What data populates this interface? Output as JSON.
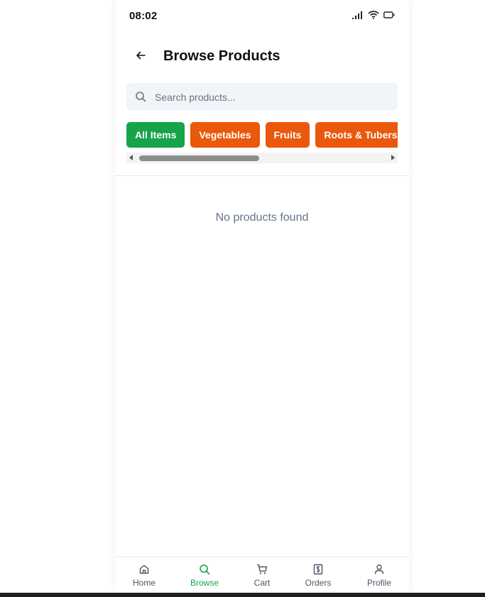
{
  "status_bar": {
    "time": "08:02"
  },
  "header": {
    "title": "Browse Products"
  },
  "search": {
    "placeholder": "Search products..."
  },
  "categories": {
    "items": [
      {
        "label": "All Items",
        "active": true
      },
      {
        "label": "Vegetables",
        "active": false
      },
      {
        "label": "Fruits",
        "active": false
      },
      {
        "label": "Roots & Tubers",
        "active": false
      }
    ]
  },
  "main": {
    "empty_message": "No products found"
  },
  "tabbar": {
    "items": [
      {
        "label": "Home",
        "icon": "home-icon",
        "active": false
      },
      {
        "label": "Browse",
        "icon": "search-icon",
        "active": true
      },
      {
        "label": "Cart",
        "icon": "cart-icon",
        "active": false
      },
      {
        "label": "Orders",
        "icon": "receipt-icon",
        "active": false
      },
      {
        "label": "Profile",
        "icon": "user-icon",
        "active": false
      }
    ]
  },
  "colors": {
    "accent_green": "#16a34a",
    "accent_orange": "#ea580c",
    "muted_text": "#64748b"
  }
}
